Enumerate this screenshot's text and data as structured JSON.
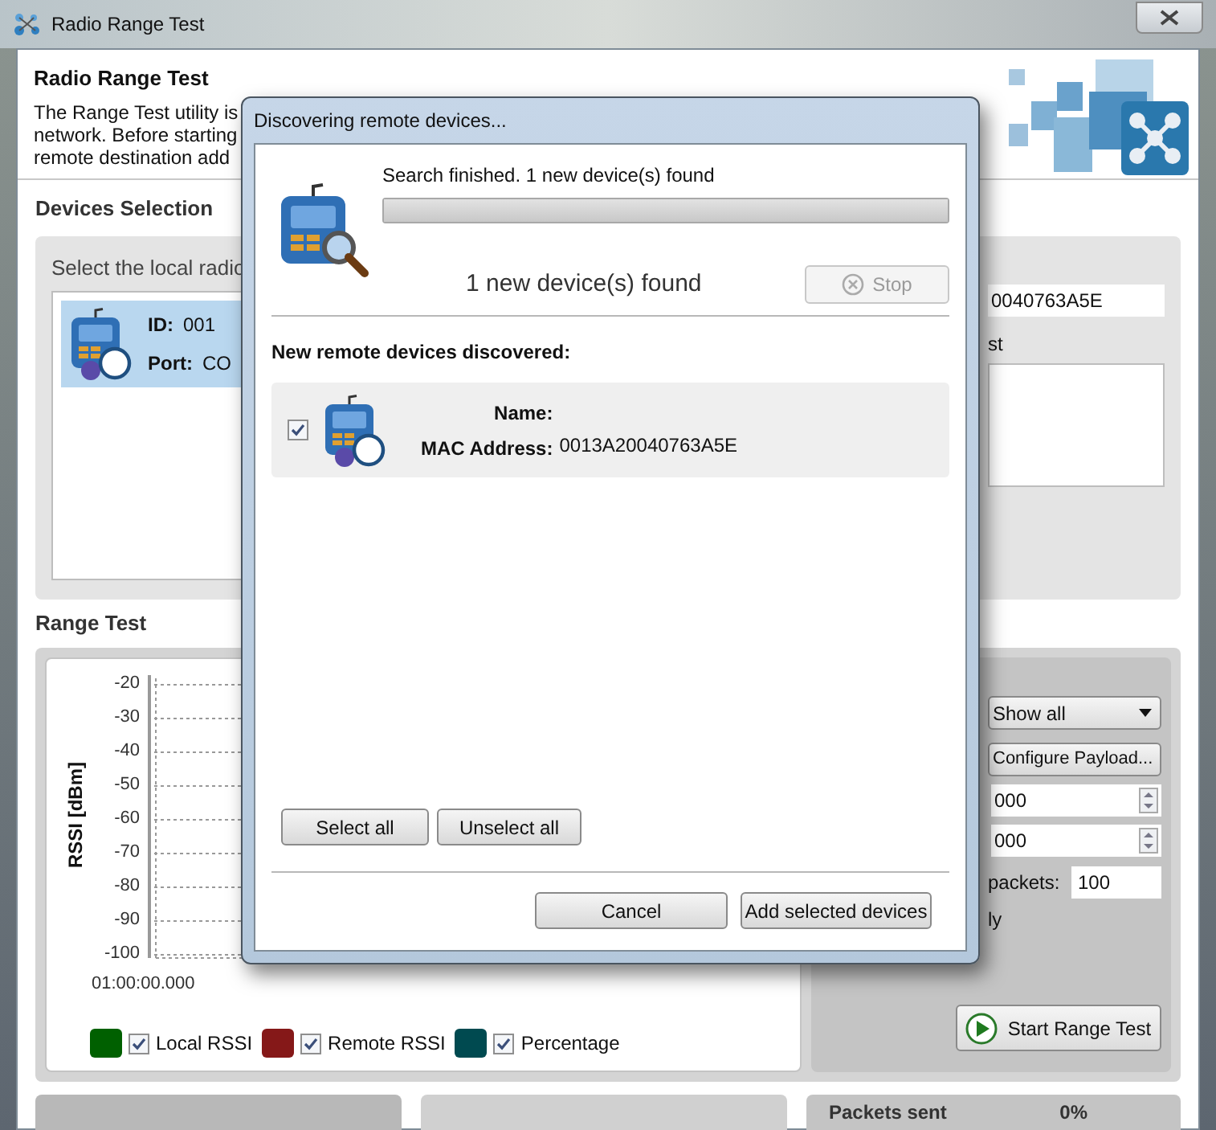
{
  "window": {
    "title": "Radio Range Test"
  },
  "header": {
    "title": "Radio Range Test",
    "description_lines": [
      "The Range Test utility is",
      "network. Before starting",
      "remote destination add"
    ]
  },
  "devices_selection": {
    "title": "Devices Selection",
    "prompt": "Select the local radio",
    "local_devices": [
      {
        "id_label": "ID:",
        "id_value": "001",
        "port_label": "Port:",
        "port_value": "CO",
        "selected": true
      }
    ],
    "remote_address": "0040763A5E",
    "list_label": "st"
  },
  "range_test": {
    "title": "Range Test",
    "chart": {
      "y_axis_label": "RSSI [dBm]",
      "y_ticks": [
        "-20",
        "-30",
        "-40",
        "-50",
        "-60",
        "-70",
        "-80",
        "-90",
        "-100"
      ],
      "x_ticks": [
        "01:00:00.000"
      ]
    },
    "legend": [
      {
        "label": "Local RSSI",
        "color": "#006000",
        "checked": true
      },
      {
        "label": "Remote RSSI",
        "color": "#851818",
        "checked": true
      },
      {
        "label": "Percentage",
        "color": "#004a50",
        "checked": true
      }
    ],
    "controls": {
      "filter": "Show all",
      "configure_button": "Configure Payload...",
      "spinners": [
        "000",
        "000"
      ],
      "packets_label": "packets:",
      "packets_value": "100",
      "option_label": "ly",
      "start_button": "Start Range Test"
    },
    "stats": {
      "packets_sent_label": "Packets sent",
      "packets_sent_value": "0%"
    }
  },
  "dialog": {
    "title": "Discovering remote devices...",
    "status": "Search finished. 1 new device(s) found",
    "progress": {
      "level": 1
    },
    "found_text": "1 new device(s) found",
    "stop_button": {
      "label": "Stop",
      "disabled": true
    },
    "list_title": "New remote devices discovered:",
    "devices": [
      {
        "name_label": "Name:",
        "mac_label": "MAC Address:",
        "mac_value": "0013A20040763A5E",
        "checked": true
      }
    ],
    "select_all": "Select all",
    "unselect_all": "Unselect all",
    "cancel": "Cancel",
    "add": "Add selected devices"
  }
}
